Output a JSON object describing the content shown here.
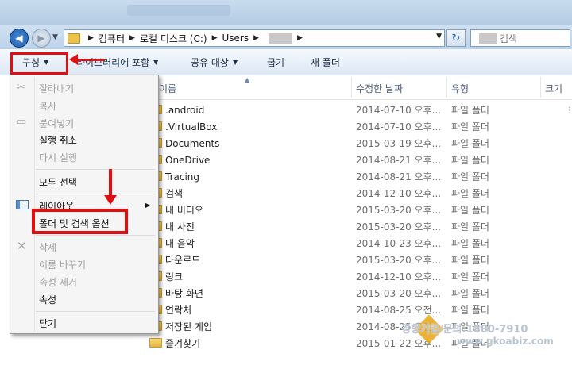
{
  "address": {
    "crumbs": [
      "컴퓨터",
      "로컬 디스크 (C:)",
      "Users"
    ]
  },
  "search": {
    "placeholder": "검색"
  },
  "toolbar": {
    "organize": "구성",
    "library": "라이브러리에 포함",
    "share": "공유 대상",
    "burn": "굽기",
    "new_folder": "새 폴더"
  },
  "columns": {
    "name": "이름",
    "modified": "수정한 날짜",
    "type": "유형",
    "size": "크기"
  },
  "files": [
    {
      "name": ".android",
      "date": "2014-07-10 오후...",
      "type": "파일 폴더"
    },
    {
      "name": ".VirtualBox",
      "date": "2014-07-10 오후...",
      "type": "파일 폴더"
    },
    {
      "name": "Documents",
      "date": "2015-03-19 오후...",
      "type": "파일 폴더"
    },
    {
      "name": "OneDrive",
      "date": "2014-08-21 오후...",
      "type": "파일 폴더"
    },
    {
      "name": "Tracing",
      "date": "2014-08-21 오후...",
      "type": "파일 폴더"
    },
    {
      "name": "검색",
      "date": "2014-12-10 오후...",
      "type": "파일 폴더"
    },
    {
      "name": "내 비디오",
      "date": "2015-03-20 오후...",
      "type": "파일 폴더"
    },
    {
      "name": "내 사진",
      "date": "2015-03-20 오후...",
      "type": "파일 폴더"
    },
    {
      "name": "내 음악",
      "date": "2014-10-23 오후...",
      "type": "파일 폴더"
    },
    {
      "name": "다운로드",
      "date": "2015-03-20 오후...",
      "type": "파일 폴더"
    },
    {
      "name": "링크",
      "date": "2014-12-10 오후...",
      "type": "파일 폴더"
    },
    {
      "name": "바탕 화면",
      "date": "2015-03-20 오후...",
      "type": "파일 폴더"
    },
    {
      "name": "연락처",
      "date": "2014-08-25 오전...",
      "type": "파일 폴더"
    },
    {
      "name": "저장된 게임",
      "date": "2014-08-25 오전...",
      "type": "파일 폴더"
    },
    {
      "name": "즐겨찾기",
      "date": "2015-01-22 오후...",
      "type": "파일 폴더"
    }
  ],
  "menu": {
    "cut": "잘라내기",
    "copy": "복사",
    "paste": "붙여넣기",
    "undo": "실행 취소",
    "redo": "다시 실행",
    "select_all": "모두 선택",
    "layout": "레이아웃",
    "folder_options": "폴더 및 검색 옵션",
    "delete": "삭제",
    "rename": "이름 바꾸기",
    "remove_props": "속성 제거",
    "properties": "속성",
    "close": "닫기"
  },
  "watermark": {
    "line1": "경향기업/문의:1800-7910",
    "line2": "www.gkoabiz.com"
  }
}
